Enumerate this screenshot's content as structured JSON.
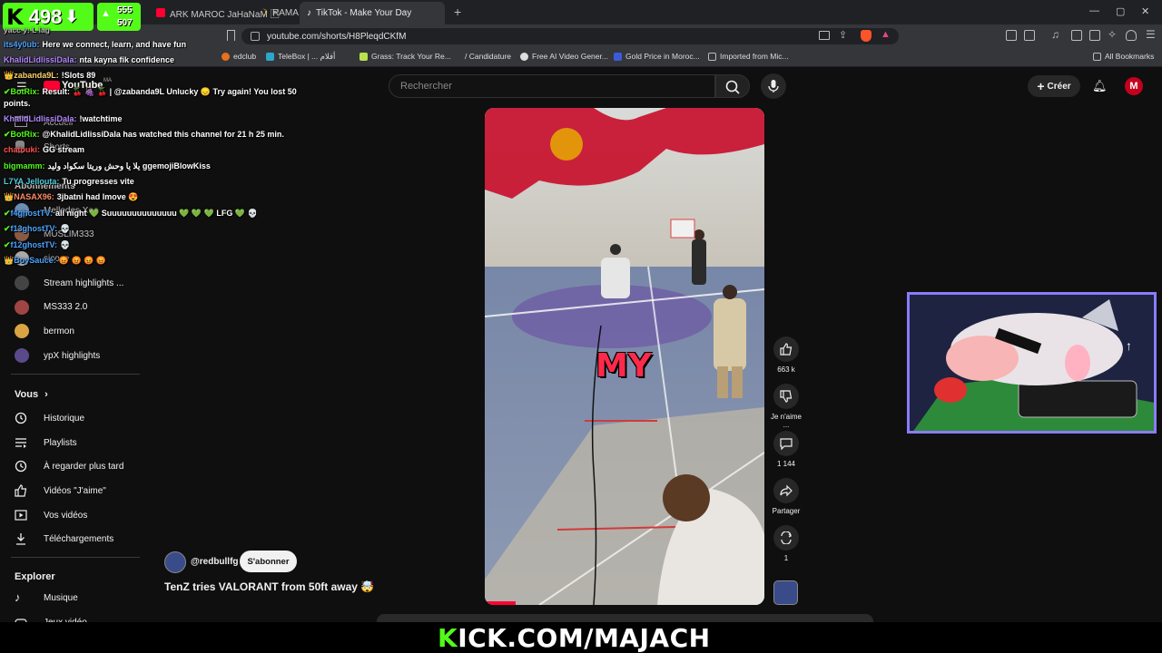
{
  "browser": {
    "tabs": [
      {
        "label": "ARK MAROC JaHaNaM 🄵 ",
        "icon": "youtube-icon"
      },
      {
        "label": "RAMA",
        "icon": "moon-icon"
      },
      {
        "label": "TikTok - Make Your Day",
        "icon": "tiktok-icon"
      }
    ],
    "new_tab": "+",
    "url": "youtube.com/shorts/H8PleqdCKfM",
    "bookmarks": [
      {
        "label": "edclub",
        "color": "#e8711a"
      },
      {
        "label": "TeleBox | ... أفلام",
        "color": "#2aa8c9"
      },
      {
        "label": "Grass: Track Your Re...",
        "color": "#b7e34d"
      },
      {
        "label": "/ Candidature",
        "color": ""
      },
      {
        "label": "Free AI Video Gener...",
        "color": "#dddddd"
      },
      {
        "label": "Gold Price in Moroc...",
        "color": "#3b5bdb"
      },
      {
        "label": "Imported from Mic...",
        "color": "#999999"
      }
    ],
    "all_bookmarks": "All Bookmarks",
    "window_controls": [
      "—",
      "▢",
      "✕"
    ]
  },
  "kick_overlay": {
    "logo": "K",
    "viewers": "498",
    "followers_top": "555",
    "followers_bottom": "507"
  },
  "chat": [
    {
      "user": "yacc y: L lag",
      "msg": "",
      "color": "#bbbbbb"
    },
    {
      "user": "its4y0ub:",
      "msg": "Here we connect, learn, and have fun",
      "color": "#4aa3ff"
    },
    {
      "user": "KhalidLidlissiDala:",
      "msg": "nta kayna fik confidence",
      "color": "#b388ff"
    },
    {
      "user": "zabanda9L:",
      "msg": "!Slots 89",
      "color": "#ffd36b"
    },
    {
      "user": "BotRix:",
      "msg": "Result: 🍒 🍇 🍒 | @zabanda9L Unlucky 😞 Try again! You lost 50",
      "color": "#53fc18"
    },
    {
      "user": "",
      "msg": "points.",
      "color": "#ffffff"
    },
    {
      "user": "KhalidLidlissiDala:",
      "msg": "!watchtime",
      "color": "#b388ff"
    },
    {
      "user": "BotRix:",
      "msg": "@KhalidLidlissiDala has watched this channel for 21 h 25 min.",
      "color": "#53fc18"
    },
    {
      "user": "chatouki:",
      "msg": "GG stream",
      "color": "#ff4d4d"
    },
    {
      "user": "bigmamm:",
      "msg": "يلا يا وحش وريتا سكواد وليد ggemojiBlowKiss",
      "color": "#53fc18"
    },
    {
      "user": "L7YA Jellouta:",
      "msg": "Tu progresses vite",
      "color": "#4dd0e1"
    },
    {
      "user": "NASAX96:",
      "msg": "3jbatni had lmove 😍",
      "color": "#ff8a65"
    },
    {
      "user": "f4ghostTV:",
      "msg": "all night 💚 Suuuuuuuuuuuuuu 💚 💚 💚 LFG 💚 💀",
      "color": "#4aa3ff"
    },
    {
      "user": "f13ghostTV:",
      "msg": "💀",
      "color": "#4aa3ff"
    },
    {
      "user": "f12ghostTV:",
      "msg": "💀",
      "color": "#4aa3ff"
    },
    {
      "user": "BoySauce:",
      "msg": "😡 😡 😡 😡",
      "color": "#4aa3ff"
    }
  ],
  "youtube": {
    "logo": "YouTube",
    "region": "MA",
    "search_placeholder": "Rechercher",
    "create_label": "Créer",
    "avatar_letter": "M",
    "sidebar": {
      "home": "Accueil",
      "shorts": "Shorts",
      "subscriptions": "Abonnements",
      "channels": [
        {
          "name": "Mellodes Xeo",
          "color": "#6b8fb5"
        },
        {
          "name": "MUSLIM333",
          "color": "#8a5a44"
        },
        {
          "name": "sicoce",
          "color": "#aaaaaa"
        },
        {
          "name": "Stream highlights ...",
          "color": "#444444"
        },
        {
          "name": "MS333 2.0",
          "color": "#a04444"
        },
        {
          "name": "bermon",
          "color": "#d9a441"
        },
        {
          "name": "ypX highlights",
          "color": "#5a4a8a"
        }
      ],
      "you_header": "Vous",
      "you_items": [
        {
          "label": "Historique",
          "icon": "history-icon"
        },
        {
          "label": "Playlists",
          "icon": "playlist-icon"
        },
        {
          "label": "À regarder plus tard",
          "icon": "clock-icon"
        },
        {
          "label": "Vidéos \"J'aime\"",
          "icon": "thumbs-up-icon"
        },
        {
          "label": "Vos vidéos",
          "icon": "video-icon"
        },
        {
          "label": "Téléchargements",
          "icon": "download-icon"
        }
      ],
      "explore_header": "Explorer",
      "explore_items": [
        {
          "label": "Musique",
          "icon": "music-icon"
        },
        {
          "label": "Jeux vidéo",
          "icon": "gamepad-icon"
        }
      ]
    },
    "short": {
      "caption_overlay": "MY",
      "channel": "@redbullfg",
      "subscribe": "S'abonner",
      "title": "TenZ tries VALORANT from 50ft away 🤯",
      "likes": "663 k",
      "dislike": "Je n'aime ...",
      "comments": "1 144",
      "share": "Partager",
      "remix": "1"
    }
  },
  "banner": {
    "k": "K",
    "text": "ICK.COM/MAJACH"
  }
}
